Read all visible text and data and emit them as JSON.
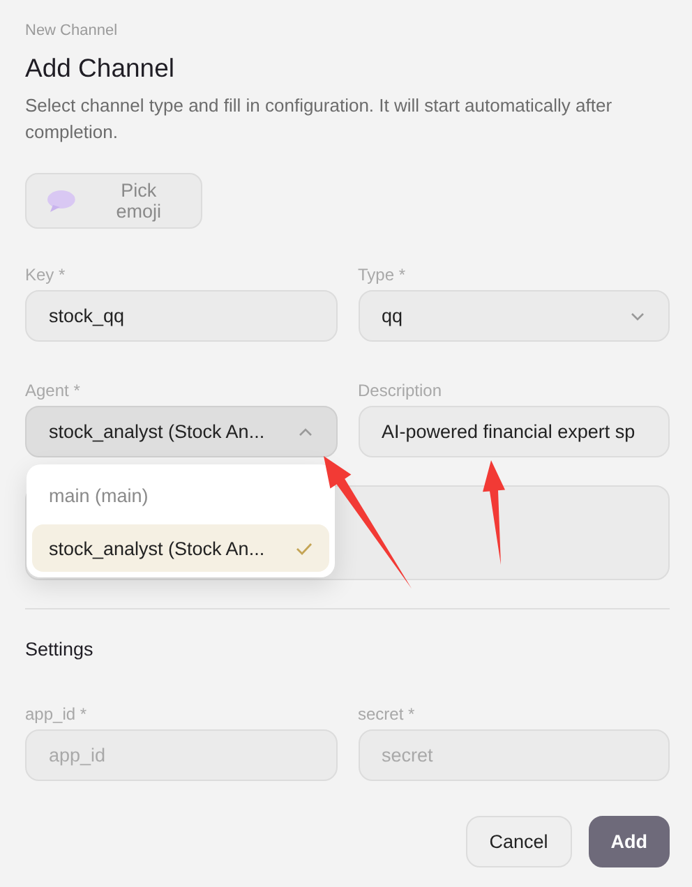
{
  "dialog": {
    "eyebrow": "New Channel",
    "title": "Add Channel",
    "description": "Select channel type and fill in configuration. It will start automatically after completion.",
    "emoji_button": {
      "label": "Pick emoji"
    },
    "fields": [
      {
        "kind": "text",
        "label": "Key *",
        "value": "stock_qq"
      },
      {
        "kind": "select",
        "label": "Type *",
        "value": "qq",
        "expanded": false
      },
      {
        "kind": "select",
        "label": "Agent *",
        "value": "stock_analyst (Stock An...",
        "expanded": true,
        "options": [
          {
            "label": "main (main)",
            "selected": false
          },
          {
            "label": "stock_analyst (Stock An...",
            "selected": true
          }
        ]
      },
      {
        "kind": "text",
        "label": "Description",
        "value": "AI-powered financial expert sp"
      },
      {
        "kind": "textarea"
      }
    ],
    "settings": {
      "title": "Settings",
      "fields": [
        {
          "label": "app_id *",
          "placeholder": "app_id"
        },
        {
          "label": "secret *",
          "placeholder": "secret"
        }
      ]
    },
    "buttons": [
      {
        "kind": "secondary",
        "label": "Cancel"
      },
      {
        "kind": "primary",
        "label": "Add"
      }
    ]
  }
}
